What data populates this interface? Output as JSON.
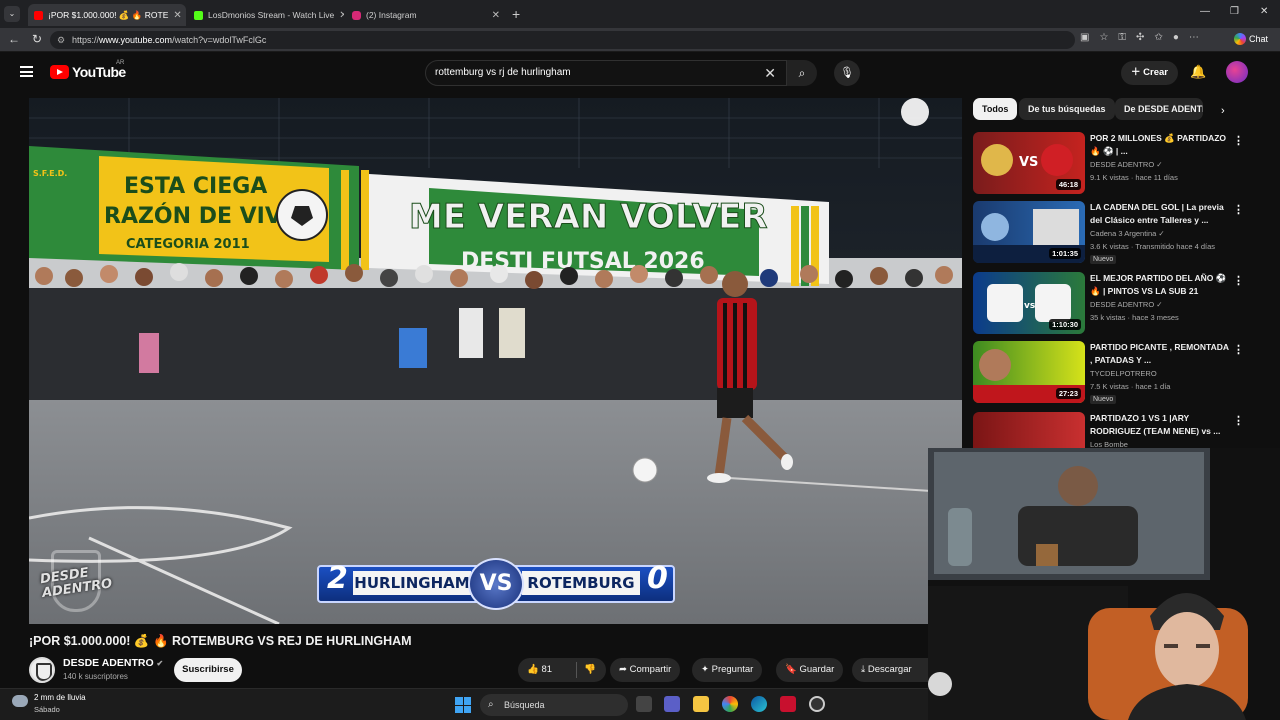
{
  "browser": {
    "tabs": [
      {
        "title": "¡POR $1.000.000! 💰 🔥 ROTE",
        "fav_color": "#ff0000",
        "active": true
      },
      {
        "title": "LosDmonios Stream - Watch Live",
        "fav_color": "#53fc18",
        "active": false
      },
      {
        "title": "(2) Instagram",
        "fav_color": "#d62976",
        "active": false
      }
    ],
    "url_prefix": "https://",
    "url_host": "www.youtube.com",
    "url_path": "/watch?v=wdolTwFclGc",
    "chat_label": "Chat"
  },
  "youtube": {
    "logo_text": "YouTube",
    "country_code": "AR",
    "search_value": "rottemburg vs rj de hurlingham",
    "create_label": "Crear"
  },
  "video": {
    "title": "¡POR $1.000.000! 💰 🔥 ROTEMBURG VS REJ DE HURLINGHAM",
    "scoreboard": {
      "home_score": "2",
      "home_team": "HURLINGHAM",
      "vs": "VS",
      "away_team": "ROTEMBURG",
      "away_score": "0"
    },
    "watermark": "DESDE ADENTRO",
    "banners": {
      "left_line1": "ESTA CIEGA",
      "left_line2": "RAZÓN DE VIVIR",
      "left_line3": "CATEGORIA 2011",
      "right_line1": "ME VERAN VOLVER",
      "right_line2": "DESTI FUTSAL 2026",
      "badge": "S.F.E.D."
    }
  },
  "channel": {
    "name": "DESDE ADENTRO",
    "subscribers": "140 k suscriptores",
    "subscribe_label": "Suscribirse"
  },
  "actions": {
    "likes": "81",
    "share": "Compartir",
    "ask": "Preguntar",
    "save": "Guardar",
    "download": "Descargar"
  },
  "chips": [
    "Todos",
    "De tus búsquedas",
    "De DESDE ADENTR"
  ],
  "recommendations": [
    {
      "title": "POR 2 MILLONES 💰 PARTIDAZO 🔥 ⚽ | ...",
      "channel": "DESDE ADENTRO ✓",
      "meta": "9.1 K vistas · hace 11 días",
      "duration": "46:18",
      "badge": "",
      "thumb_colors": [
        "#7a1c1c",
        "#c5231f"
      ]
    },
    {
      "title": "LA CADENA DEL GOL | La previa del Clásico entre Talleres y ...",
      "channel": "Cadena 3 Argentina ✓",
      "meta": "3.6 K vistas · Transmitido hace 4 días",
      "duration": "1:01:35",
      "badge": "Nuevo",
      "thumb_colors": [
        "#1a3a6e",
        "#2a6bb5"
      ]
    },
    {
      "title": "EL MEJOR PARTIDO DEL AÑO ⚽ 🔥 | PINTOS VS LA SUB 21",
      "channel": "DESDE ADENTRO ✓",
      "meta": "35 k vistas · hace 3 meses",
      "duration": "1:10:30",
      "badge": "",
      "thumb_colors": [
        "#0b3b8c",
        "#2b7a3a"
      ]
    },
    {
      "title": "PARTIDO PICANTE , REMONTADA , PATADAS Y ...",
      "channel": "TYCDELPOTRERO",
      "meta": "7.5 K vistas · hace 1 día",
      "duration": "27:23",
      "badge": "Nuevo",
      "thumb_colors": [
        "#3c8a21",
        "#d6e21a"
      ]
    },
    {
      "title": "PARTIDAZO 1 VS 1 |ARY RODRIGUEZ (TEAM NENE) vs ...",
      "channel": "Los Bombe",
      "meta": "",
      "duration": "",
      "badge": "",
      "thumb_colors": [
        "#7a1515",
        "#c93030"
      ]
    }
  ],
  "taskbar": {
    "weather_text": "2 mm de lluvia",
    "weather_day": "Sábado",
    "search_label": "Búsqueda"
  },
  "colors": {
    "background": "#0f0f0f",
    "accent_red": "#ff0000",
    "chip_bg": "#272727",
    "text": "#f1f1f1",
    "muted": "#aaaaaa"
  }
}
